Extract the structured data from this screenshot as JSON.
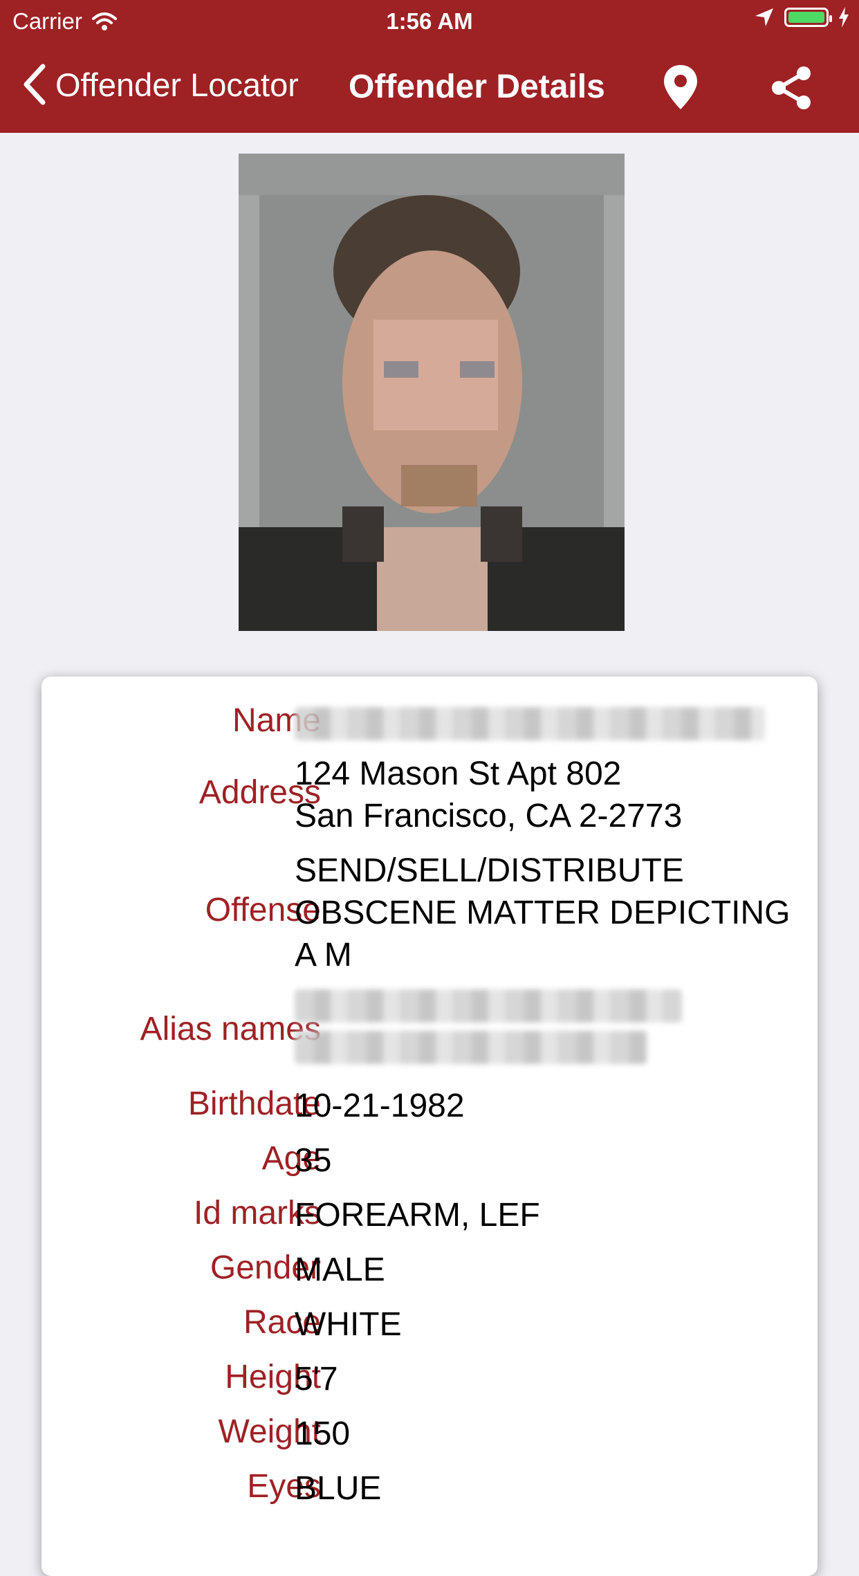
{
  "status_bar": {
    "carrier": "Carrier",
    "time": "1:56 AM",
    "battery_color": "#4cd964"
  },
  "nav": {
    "back_label": "Offender Locator",
    "title": "Offender Details",
    "location_icon": "map-pin-icon",
    "share_icon": "share-icon",
    "bar_color": "#9e2124"
  },
  "details": {
    "name_label": "Name",
    "name_value": "",
    "address_label": "Address",
    "address_value": "124 Mason St Apt 802\nSan Francisco, CA 2-2773",
    "offense_label": "Offense",
    "offense_value": "SEND/SELL/DISTRIBUTE\nOBSCENE MATTER DEPICTING\nA M",
    "alias_label": "Alias names",
    "alias_value": "",
    "birthdate_label": "Birthdate",
    "birthdate_value": "10-21-1982",
    "age_label": "Age",
    "age_value": "35",
    "idmarks_label": "Id marks",
    "idmarks_value": "FOREARM, LEF",
    "gender_label": "Gender",
    "gender_value": "MALE",
    "race_label": "Race",
    "race_value": "WHITE",
    "height_label": "Height",
    "height_value": "5'7",
    "weight_label": "Weight",
    "weight_value": "150",
    "eyes_label": "Eyes",
    "eyes_value": "BLUE"
  }
}
